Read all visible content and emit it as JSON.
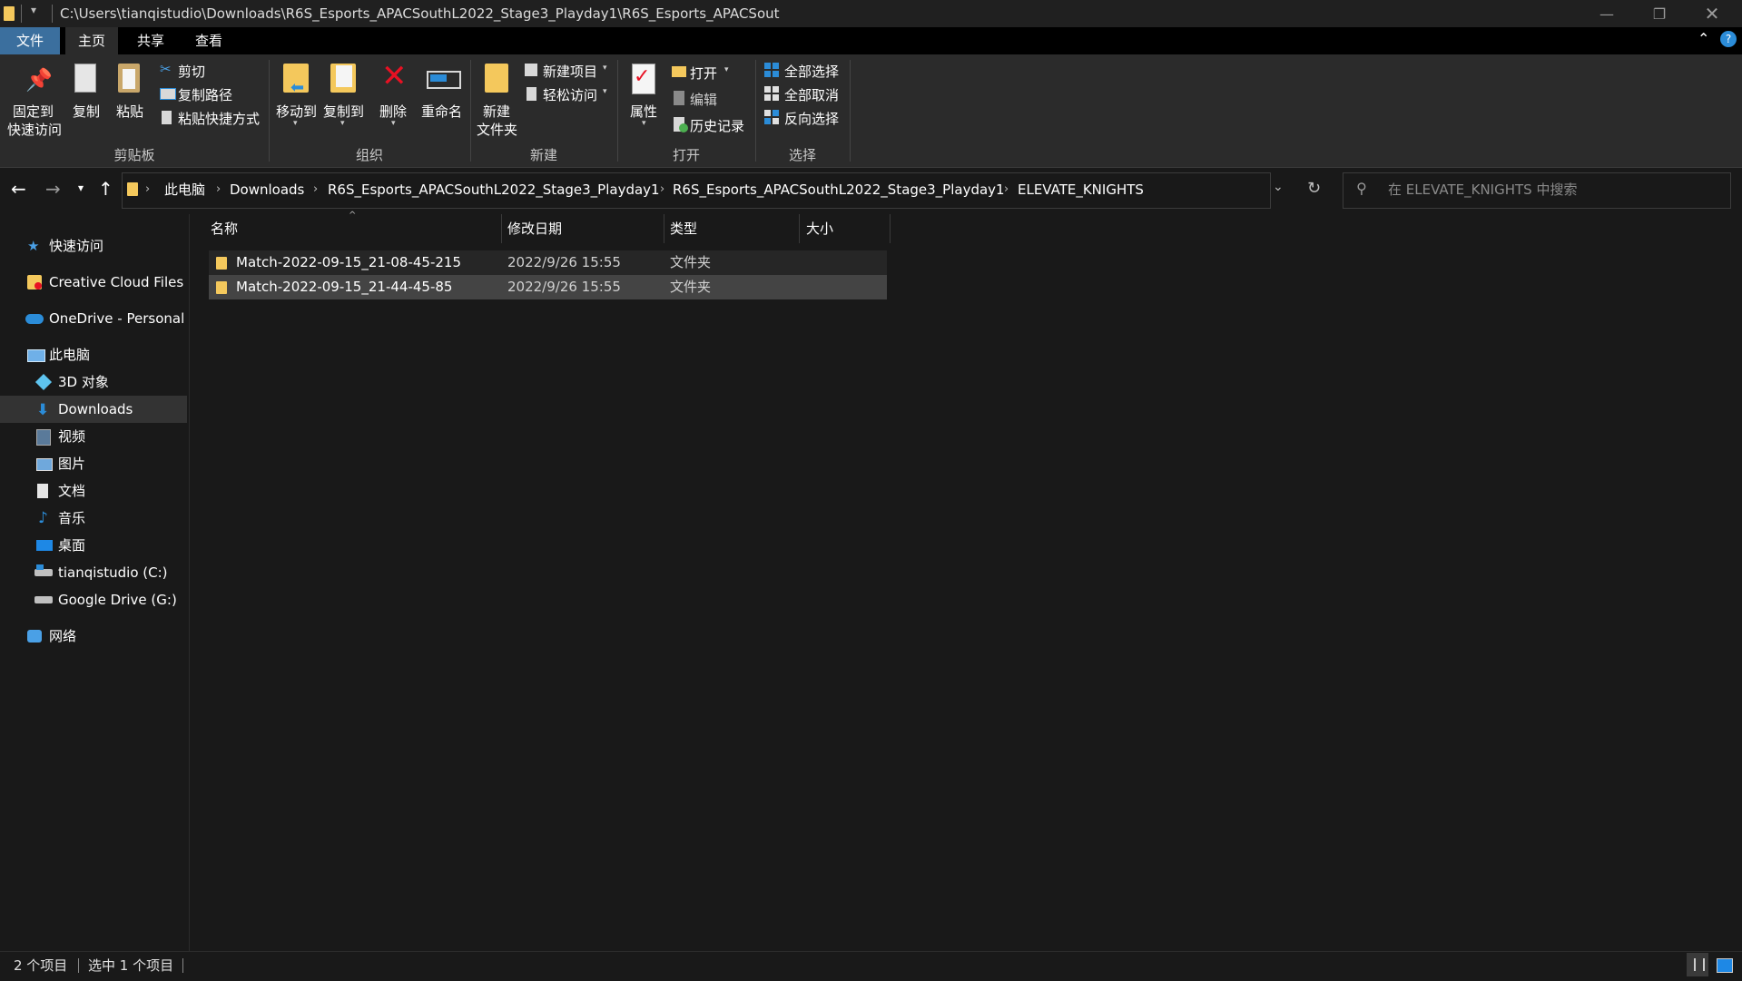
{
  "titlebar": {
    "path": "C:\\Users\\tianqistudio\\Downloads\\R6S_Esports_APACSouthL2022_Stage3_Playday1\\R6S_Esports_APACSout"
  },
  "tabs": [
    "文件",
    "主页",
    "共享",
    "查看"
  ],
  "ribbon": {
    "clipboard": {
      "pin": "固定到\n快速访问",
      "pin_l1": "固定到",
      "pin_l2": "快速访问",
      "copy": "复制",
      "paste": "粘贴",
      "cut": "剪切",
      "copy_path": "复制路径",
      "paste_shortcut": "粘贴快捷方式",
      "group": "剪贴板"
    },
    "organize": {
      "move_to": "移动到",
      "copy_to": "复制到",
      "delete": "删除",
      "rename": "重命名",
      "group": "组织"
    },
    "new": {
      "new_folder_l1": "新建",
      "new_folder_l2": "文件夹",
      "new_item": "新建项目",
      "easy_access": "轻松访问",
      "group": "新建"
    },
    "open": {
      "properties": "属性",
      "open": "打开",
      "edit": "编辑",
      "history": "历史记录",
      "group": "打开"
    },
    "select": {
      "select_all": "全部选择",
      "select_none": "全部取消",
      "invert": "反向选择",
      "group": "选择"
    }
  },
  "address": {
    "crumbs": [
      "此电脑",
      "Downloads",
      "R6S_Esports_APACSouthL2022_Stage3_Playday1",
      "R6S_Esports_APACSouthL2022_Stage3_Playday1",
      "ELEVATE_KNIGHTS"
    ],
    "search_placeholder": "在 ELEVATE_KNIGHTS 中搜索"
  },
  "nav": {
    "quick_access": "快速访问",
    "creative_cloud": "Creative Cloud Files",
    "onedrive": "OneDrive - Personal",
    "this_pc": "此电脑",
    "objects3d": "3D 对象",
    "downloads": "Downloads",
    "videos": "视频",
    "pictures": "图片",
    "documents": "文档",
    "music": "音乐",
    "desktop": "桌面",
    "drive_c": "tianqistudio (C:)",
    "drive_g": "Google Drive (G:)",
    "network": "网络"
  },
  "columns": {
    "name": "名称",
    "modified": "修改日期",
    "type": "类型",
    "size": "大小"
  },
  "files": [
    {
      "name": "Match-2022-09-15_21-08-45-215",
      "modified": "2022/9/26 15:55",
      "type": "文件夹",
      "size": ""
    },
    {
      "name": "Match-2022-09-15_21-44-45-85",
      "modified": "2022/9/26 15:55",
      "type": "文件夹",
      "size": ""
    }
  ],
  "status": {
    "count": "2 个项目",
    "selected": "选中 1 个项目"
  },
  "colors": {
    "accent_blue": "#2b8cd8",
    "folder_yellow": "#f4c85c",
    "delete_red": "#e81123"
  }
}
